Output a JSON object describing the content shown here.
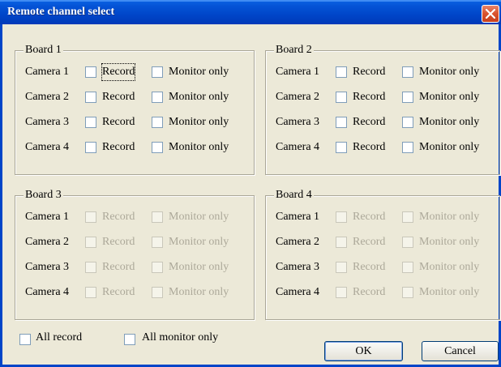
{
  "window": {
    "title": "Remote channel select",
    "close_icon": "close-icon"
  },
  "boards": [
    {
      "name": "Board 1",
      "enabled": true,
      "cameras": [
        {
          "label": "Camera 1",
          "record": "Record",
          "monitor": "Monitor only",
          "record_checked": false,
          "monitor_checked": false
        },
        {
          "label": "Camera 2",
          "record": "Record",
          "monitor": "Monitor only",
          "record_checked": false,
          "monitor_checked": false
        },
        {
          "label": "Camera 3",
          "record": "Record",
          "monitor": "Monitor only",
          "record_checked": false,
          "monitor_checked": false
        },
        {
          "label": "Camera 4",
          "record": "Record",
          "monitor": "Monitor only",
          "record_checked": false,
          "monitor_checked": false
        }
      ]
    },
    {
      "name": "Board 2",
      "enabled": true,
      "cameras": [
        {
          "label": "Camera 1",
          "record": "Record",
          "monitor": "Monitor only",
          "record_checked": false,
          "monitor_checked": false
        },
        {
          "label": "Camera 2",
          "record": "Record",
          "monitor": "Monitor only",
          "record_checked": false,
          "monitor_checked": false
        },
        {
          "label": "Camera 3",
          "record": "Record",
          "monitor": "Monitor only",
          "record_checked": false,
          "monitor_checked": false
        },
        {
          "label": "Camera 4",
          "record": "Record",
          "monitor": "Monitor only",
          "record_checked": false,
          "monitor_checked": false
        }
      ]
    },
    {
      "name": "Board 3",
      "enabled": false,
      "cameras": [
        {
          "label": "Camera 1",
          "record": "Record",
          "monitor": "Monitor only",
          "record_checked": false,
          "monitor_checked": false
        },
        {
          "label": "Camera 2",
          "record": "Record",
          "monitor": "Monitor only",
          "record_checked": false,
          "monitor_checked": false
        },
        {
          "label": "Camera 3",
          "record": "Record",
          "monitor": "Monitor only",
          "record_checked": false,
          "monitor_checked": false
        },
        {
          "label": "Camera 4",
          "record": "Record",
          "monitor": "Monitor only",
          "record_checked": false,
          "monitor_checked": false
        }
      ]
    },
    {
      "name": "Board 4",
      "enabled": false,
      "cameras": [
        {
          "label": "Camera 1",
          "record": "Record",
          "monitor": "Monitor only",
          "record_checked": false,
          "monitor_checked": false
        },
        {
          "label": "Camera 2",
          "record": "Record",
          "monitor": "Monitor only",
          "record_checked": false,
          "monitor_checked": false
        },
        {
          "label": "Camera 3",
          "record": "Record",
          "monitor": "Monitor only",
          "record_checked": false,
          "monitor_checked": false
        },
        {
          "label": "Camera 4",
          "record": "Record",
          "monitor": "Monitor only",
          "record_checked": false,
          "monitor_checked": false
        }
      ]
    }
  ],
  "footer": {
    "all_record": "All record",
    "all_monitor": "All monitor only",
    "ok": "OK",
    "cancel": "Cancel"
  },
  "colors": {
    "title_bar": "#0045c8",
    "dialog_bg": "#ece9d8",
    "disabled_text": "#aca899",
    "close_button": "#d9532e"
  }
}
